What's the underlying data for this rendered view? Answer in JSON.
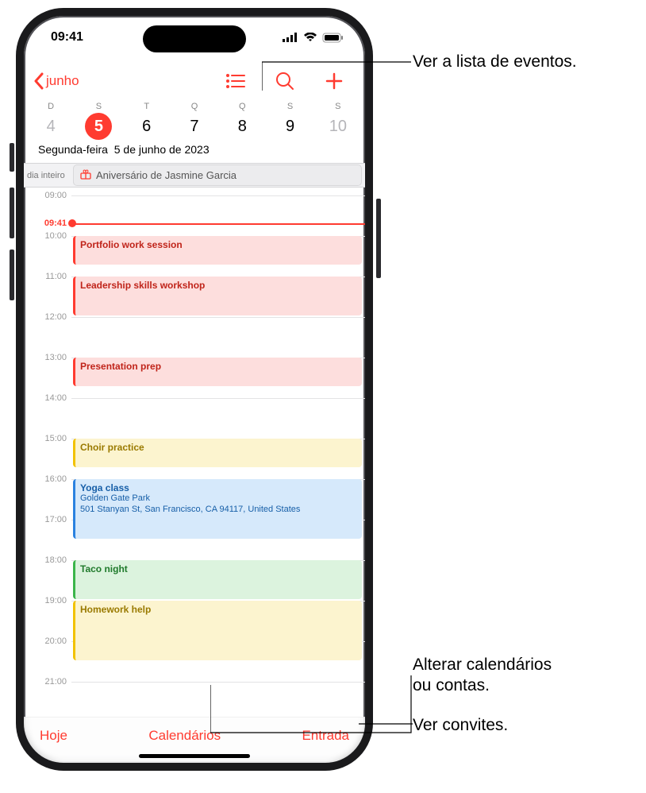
{
  "status": {
    "time": "09:41"
  },
  "nav": {
    "back": "junho"
  },
  "week": {
    "day_letters": [
      "D",
      "S",
      "T",
      "Q",
      "Q",
      "S",
      "S"
    ],
    "day_nums": [
      "4",
      "5",
      "6",
      "7",
      "8",
      "9",
      "10"
    ],
    "selected_index": 1,
    "dim_indexes": [
      0,
      6
    ],
    "date_weekday": "Segunda-feira",
    "date_full": "5 de junho de 2023"
  },
  "allday": {
    "label": "dia inteiro",
    "event_title": "Aniversário de Jasmine Garcia"
  },
  "now_label": "09:41",
  "hours": [
    "09:00",
    "10:00",
    "11:00",
    "12:00",
    "13:00",
    "14:00",
    "15:00",
    "16:00",
    "17:00",
    "18:00",
    "19:00",
    "20:00",
    "21:00"
  ],
  "events": [
    {
      "title": "Portfolio work session",
      "color": "red"
    },
    {
      "title": "Leadership skills workshop",
      "color": "red"
    },
    {
      "title": "Presentation prep",
      "color": "red"
    },
    {
      "title": "Choir practice",
      "color": "yellow"
    },
    {
      "title": "Yoga class",
      "loc1": "Golden Gate Park",
      "loc2": "501 Stanyan St, San Francisco, CA 94117, United States",
      "color": "blue"
    },
    {
      "title": "Taco night",
      "color": "green"
    },
    {
      "title": "Homework help",
      "color": "yellow"
    }
  ],
  "toolbar": {
    "today": "Hoje",
    "calendars": "Calendários",
    "inbox": "Entrada"
  },
  "callouts": {
    "list": "Ver a lista de eventos.",
    "accounts_l1": "Alterar calendários",
    "accounts_l2": "ou contas.",
    "invites": "Ver convites."
  }
}
